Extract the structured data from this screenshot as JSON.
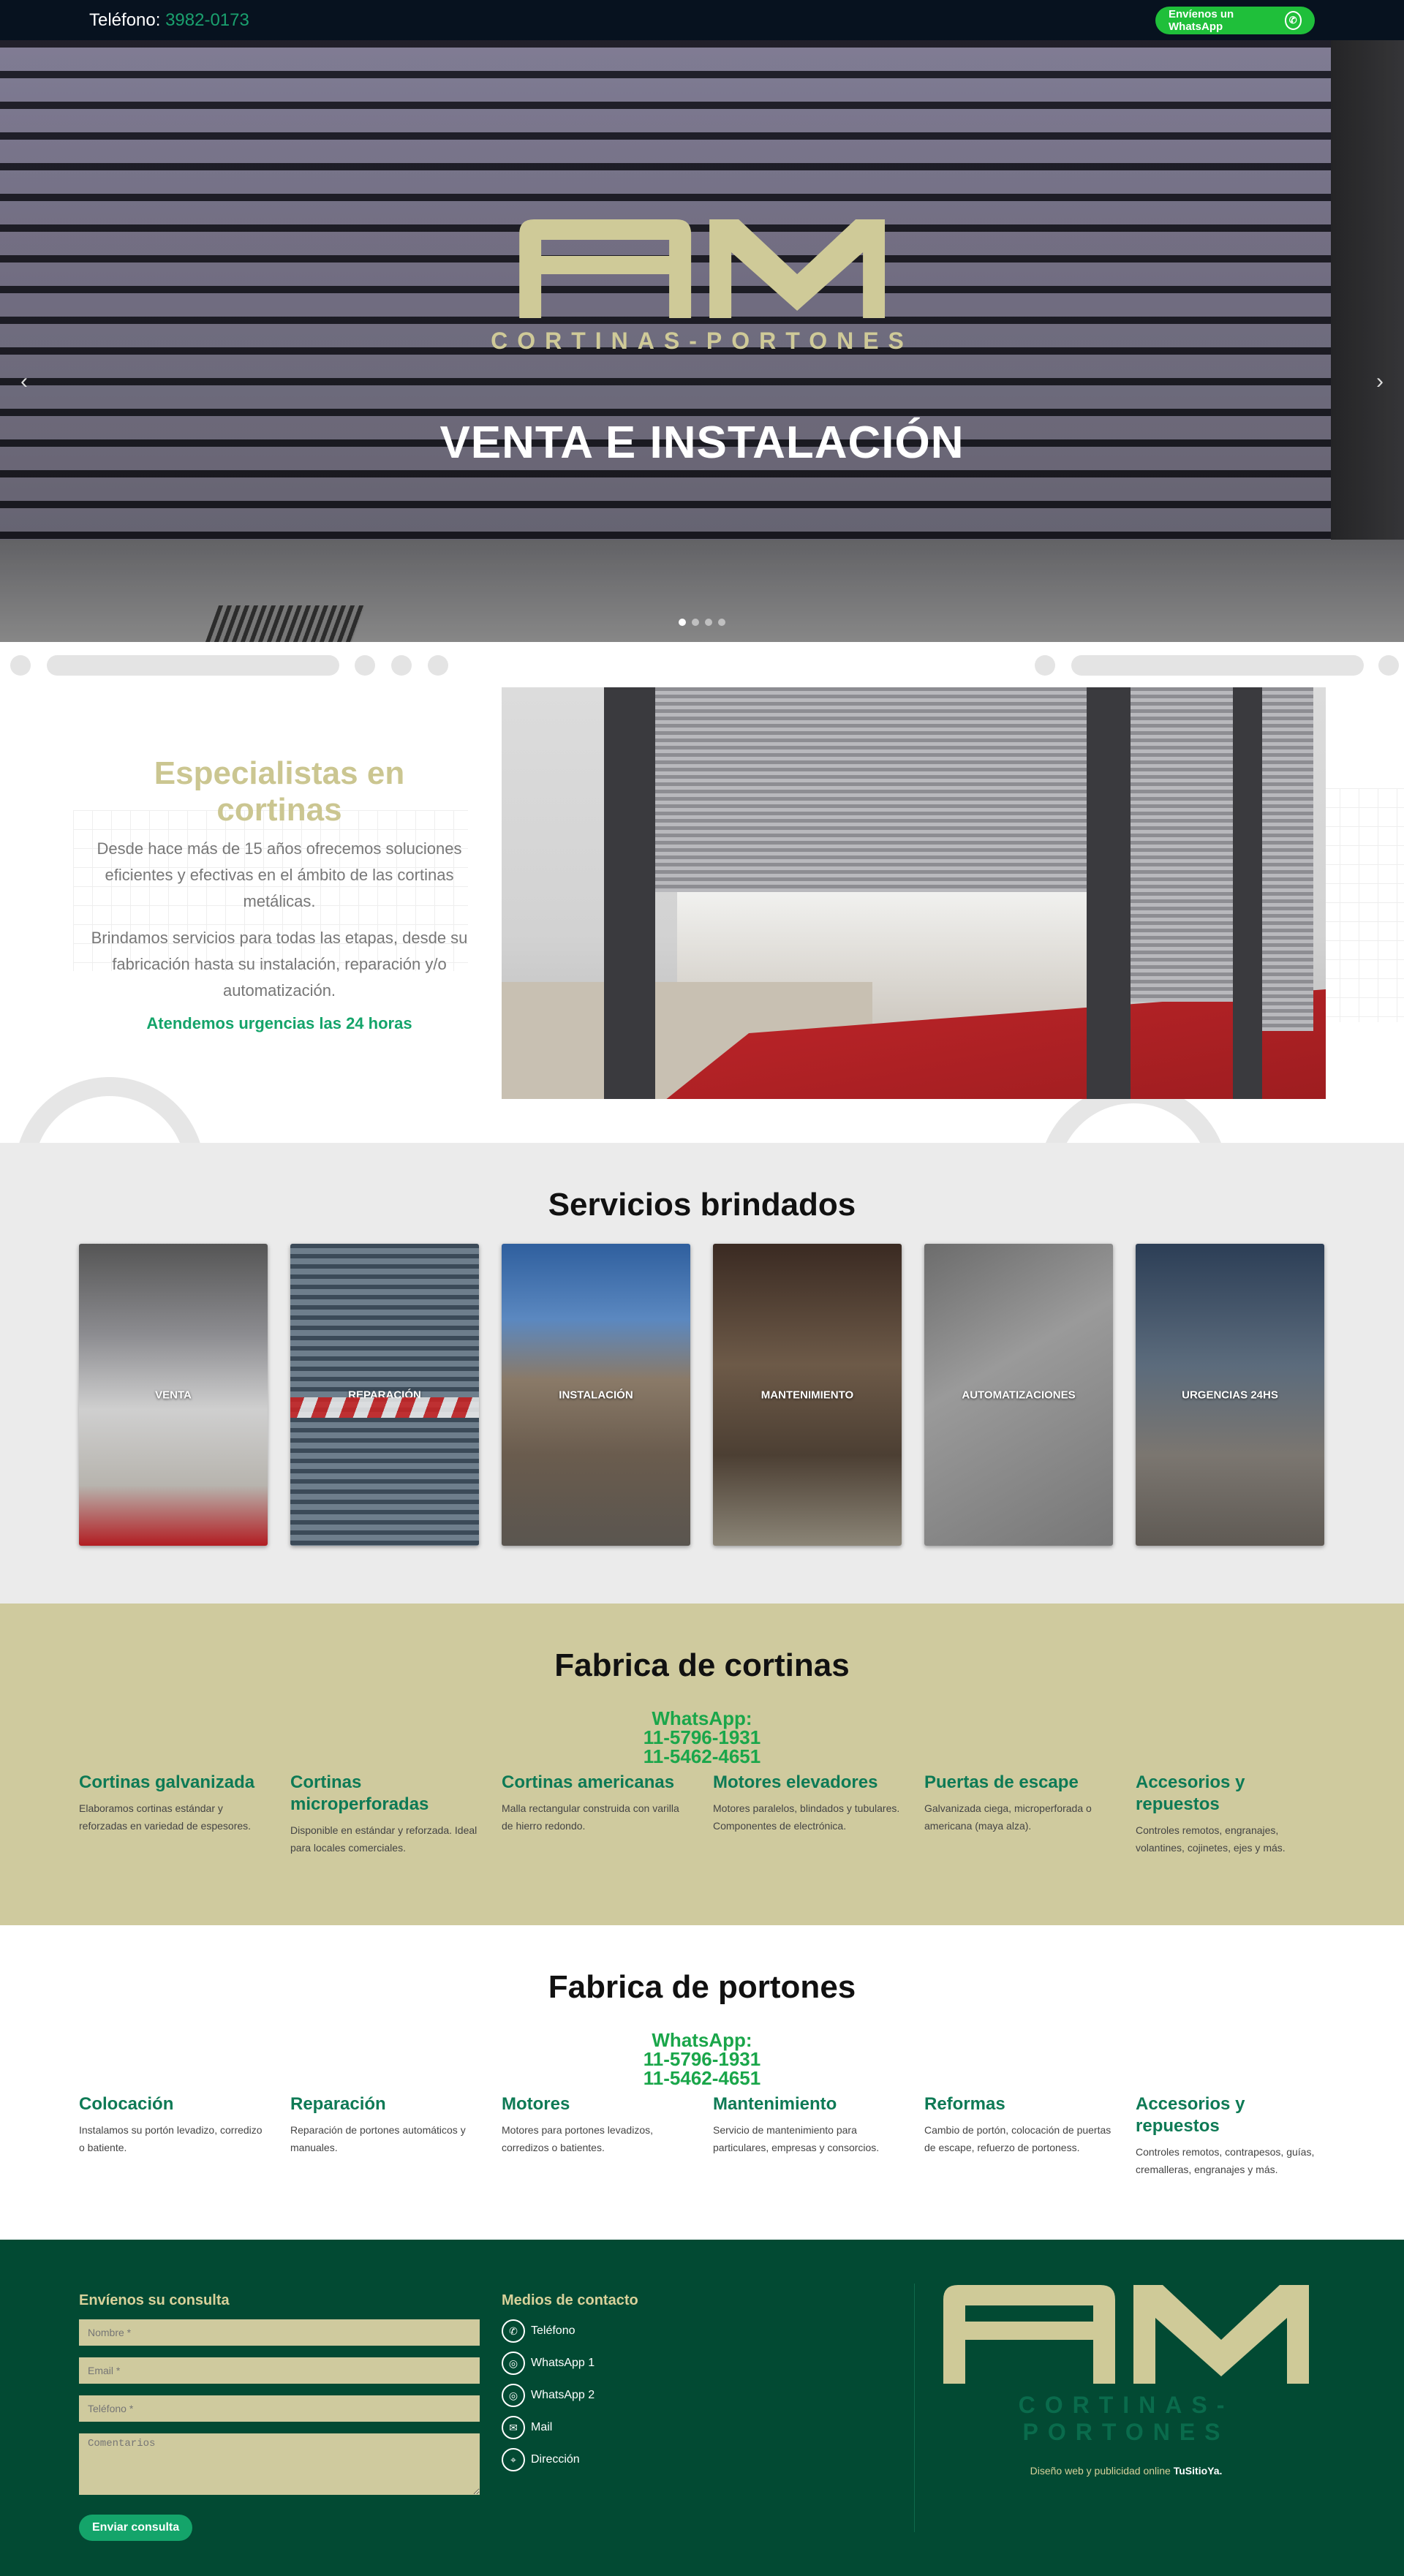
{
  "topbar": {
    "phone_label": "Teléfono:",
    "phone_number": "3982-0173",
    "whatsapp_btn": "Envíenos un WhatsApp"
  },
  "hero": {
    "logo_text": "CORTINAS-PORTONES",
    "title": "VENTA E INSTALACIÓN",
    "slides": 4,
    "active_slide": 1
  },
  "specialists": {
    "title": "Especialistas en cortinas",
    "p1": "Desde hace más de 15 años ofrecemos soluciones eficientes y efectivas en el ámbito de las cortinas metálicas.",
    "p2": "Brindamos servicios para todas las etapas, desde su fabricación hasta su instalación, reparación y/o automatización.",
    "urgent": "Atendemos urgencias las 24 horas"
  },
  "services": {
    "title": "Servicios brindados",
    "cards": [
      {
        "label": "VENTA"
      },
      {
        "label": "REPARACIÓN"
      },
      {
        "label": "INSTALACIÓN"
      },
      {
        "label": "MANTENIMIENTO"
      },
      {
        "label": "AUTOMATIZACIONES"
      },
      {
        "label": "URGENCIAS 24HS"
      }
    ]
  },
  "curtains": {
    "title": "Fabrica de cortinas",
    "wa_label": "WhatsApp:",
    "wa_1": "11-5796-1931",
    "wa_2": "11-5462-4651",
    "items": [
      {
        "title": "Cortinas galvanizada",
        "text": "Elaboramos cortinas estándar y reforzadas en variedad de espesores."
      },
      {
        "title": "Cortinas microperforadas",
        "text": "Disponible en estándar y reforzada. Ideal para locales comerciales."
      },
      {
        "title": "Cortinas americanas",
        "text": "Malla rectangular construida con varilla de hierro redondo."
      },
      {
        "title": "Motores elevadores",
        "text": "Motores paralelos, blindados y tubulares. Componentes de electrónica."
      },
      {
        "title": "Puertas de escape",
        "text": "Galvanizada ciega, microperforada o americana (maya alza)."
      },
      {
        "title": "Accesorios y repuestos",
        "text": "Controles remotos, engranajes, volantines, cojinetes, ejes y más."
      }
    ]
  },
  "gates": {
    "title": "Fabrica de portones",
    "wa_label": "WhatsApp:",
    "wa_1": "11-5796-1931",
    "wa_2": "11-5462-4651",
    "items": [
      {
        "title": "Colocación",
        "text": "Instalamos su portón levadizo, corredizo o batiente."
      },
      {
        "title": "Reparación",
        "text": "Reparación de portones automáticos y manuales."
      },
      {
        "title": "Motores",
        "text": "Motores para portones levadizos, corredizos o batientes."
      },
      {
        "title": "Mantenimiento",
        "text": "Servicio de mantenimiento para particulares, empresas y consorcios."
      },
      {
        "title": "Reformas",
        "text": "Cambio de portón, colocación de puertas de escape, refuerzo de portoness."
      },
      {
        "title": "Accesorios y repuestos",
        "text": "Controles remotos, contrapesos, guías, cremalleras, engranajes y más."
      }
    ]
  },
  "footer": {
    "form_title": "Envíenos su consulta",
    "name_ph": "Nombre *",
    "email_ph": "Email *",
    "phone_ph": "Teléfono *",
    "comments_ph": "Comentarios",
    "submit": "Enviar consulta",
    "contact_title": "Medios de contacto",
    "contacts": [
      {
        "label": "Teléfono",
        "icon": "phone-icon"
      },
      {
        "label": "WhatsApp 1",
        "icon": "whatsapp-icon"
      },
      {
        "label": "WhatsApp 2",
        "icon": "whatsapp-icon"
      },
      {
        "label": "Mail",
        "icon": "mail-icon"
      },
      {
        "label": "Dirección",
        "icon": "location-icon"
      }
    ],
    "logo_text": "CORTINAS-PORTONES",
    "credit_prefix": "Diseño web y publicidad online",
    "credit_brand": "TuSitioYa."
  },
  "colors": {
    "brand_khaki": "#cfca9e",
    "brand_green": "#024a33",
    "accent_green": "#14a46a",
    "whatsapp_green": "#1fbf3a"
  }
}
